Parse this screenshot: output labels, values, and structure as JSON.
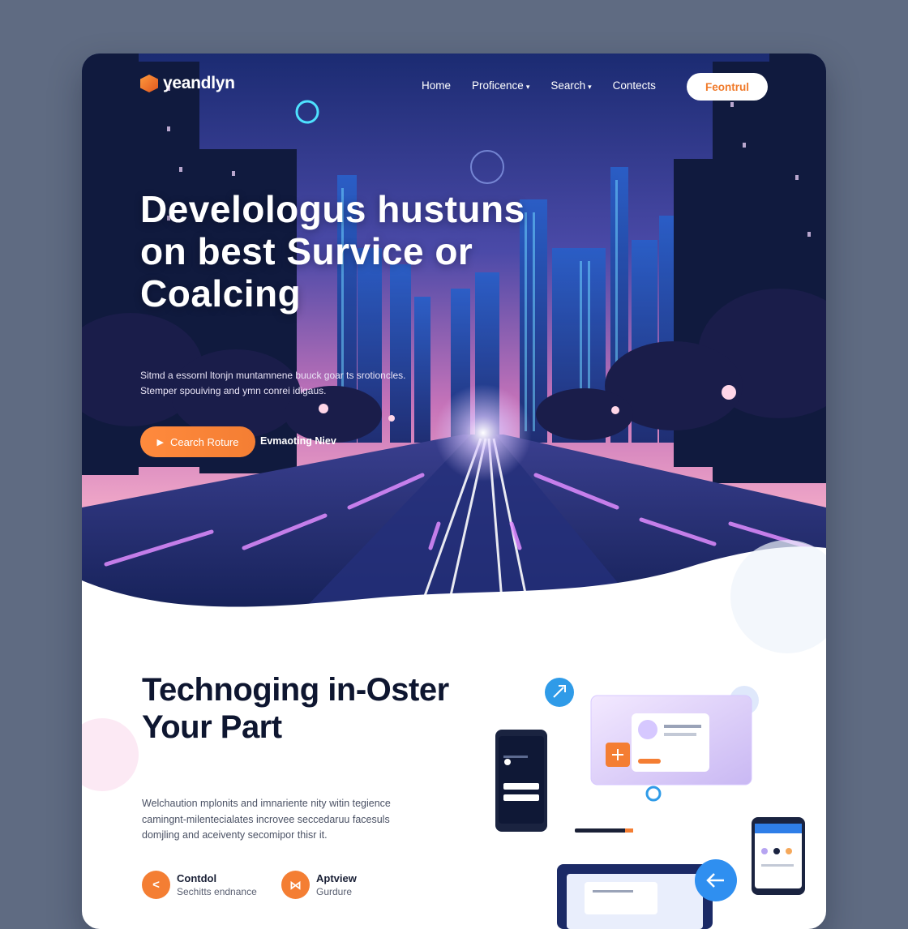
{
  "brand": {
    "name": "yeandlyn",
    "logo_icon": "cube-logo-icon"
  },
  "nav": {
    "links": [
      {
        "label": "Home",
        "has_dropdown": false
      },
      {
        "label": "Proficence",
        "has_dropdown": true
      },
      {
        "label": "Search",
        "has_dropdown": true
      },
      {
        "label": "Contects",
        "has_dropdown": false
      }
    ],
    "cta_label": "Feontrul"
  },
  "hero": {
    "title": "Develologus hustuns on best Survice or Coalcing",
    "subtitle": "Sitmd a essornl ltonjn muntamnene buuck goar ts srotioncles. Stemper spouiving and ymn conrei idigaus.",
    "cta_label": "Cearch Roture",
    "secondary_label": "Evmaoting Niev"
  },
  "section": {
    "title": "Technoging in-Oster Your Part",
    "body": "Welchaution mplonits and imnariente nity witin tegience camingnt-milentecialates incrovee seccedaruu facesuls domjling and aceiventy secomipor thisr it.",
    "features": [
      {
        "title": "Contdol",
        "subtitle": "Sechitts endnance",
        "icon": "share-icon"
      },
      {
        "title": "Aptview",
        "subtitle": "Gurdure",
        "icon": "network-icon"
      }
    ]
  },
  "colors": {
    "accent": "#f47e33",
    "page_bg": "#5f6b82",
    "sky_top": "#1c2f7a",
    "sky_bottom": "#d678b6",
    "heading": "#0e1630",
    "neon": "#c27bff"
  }
}
